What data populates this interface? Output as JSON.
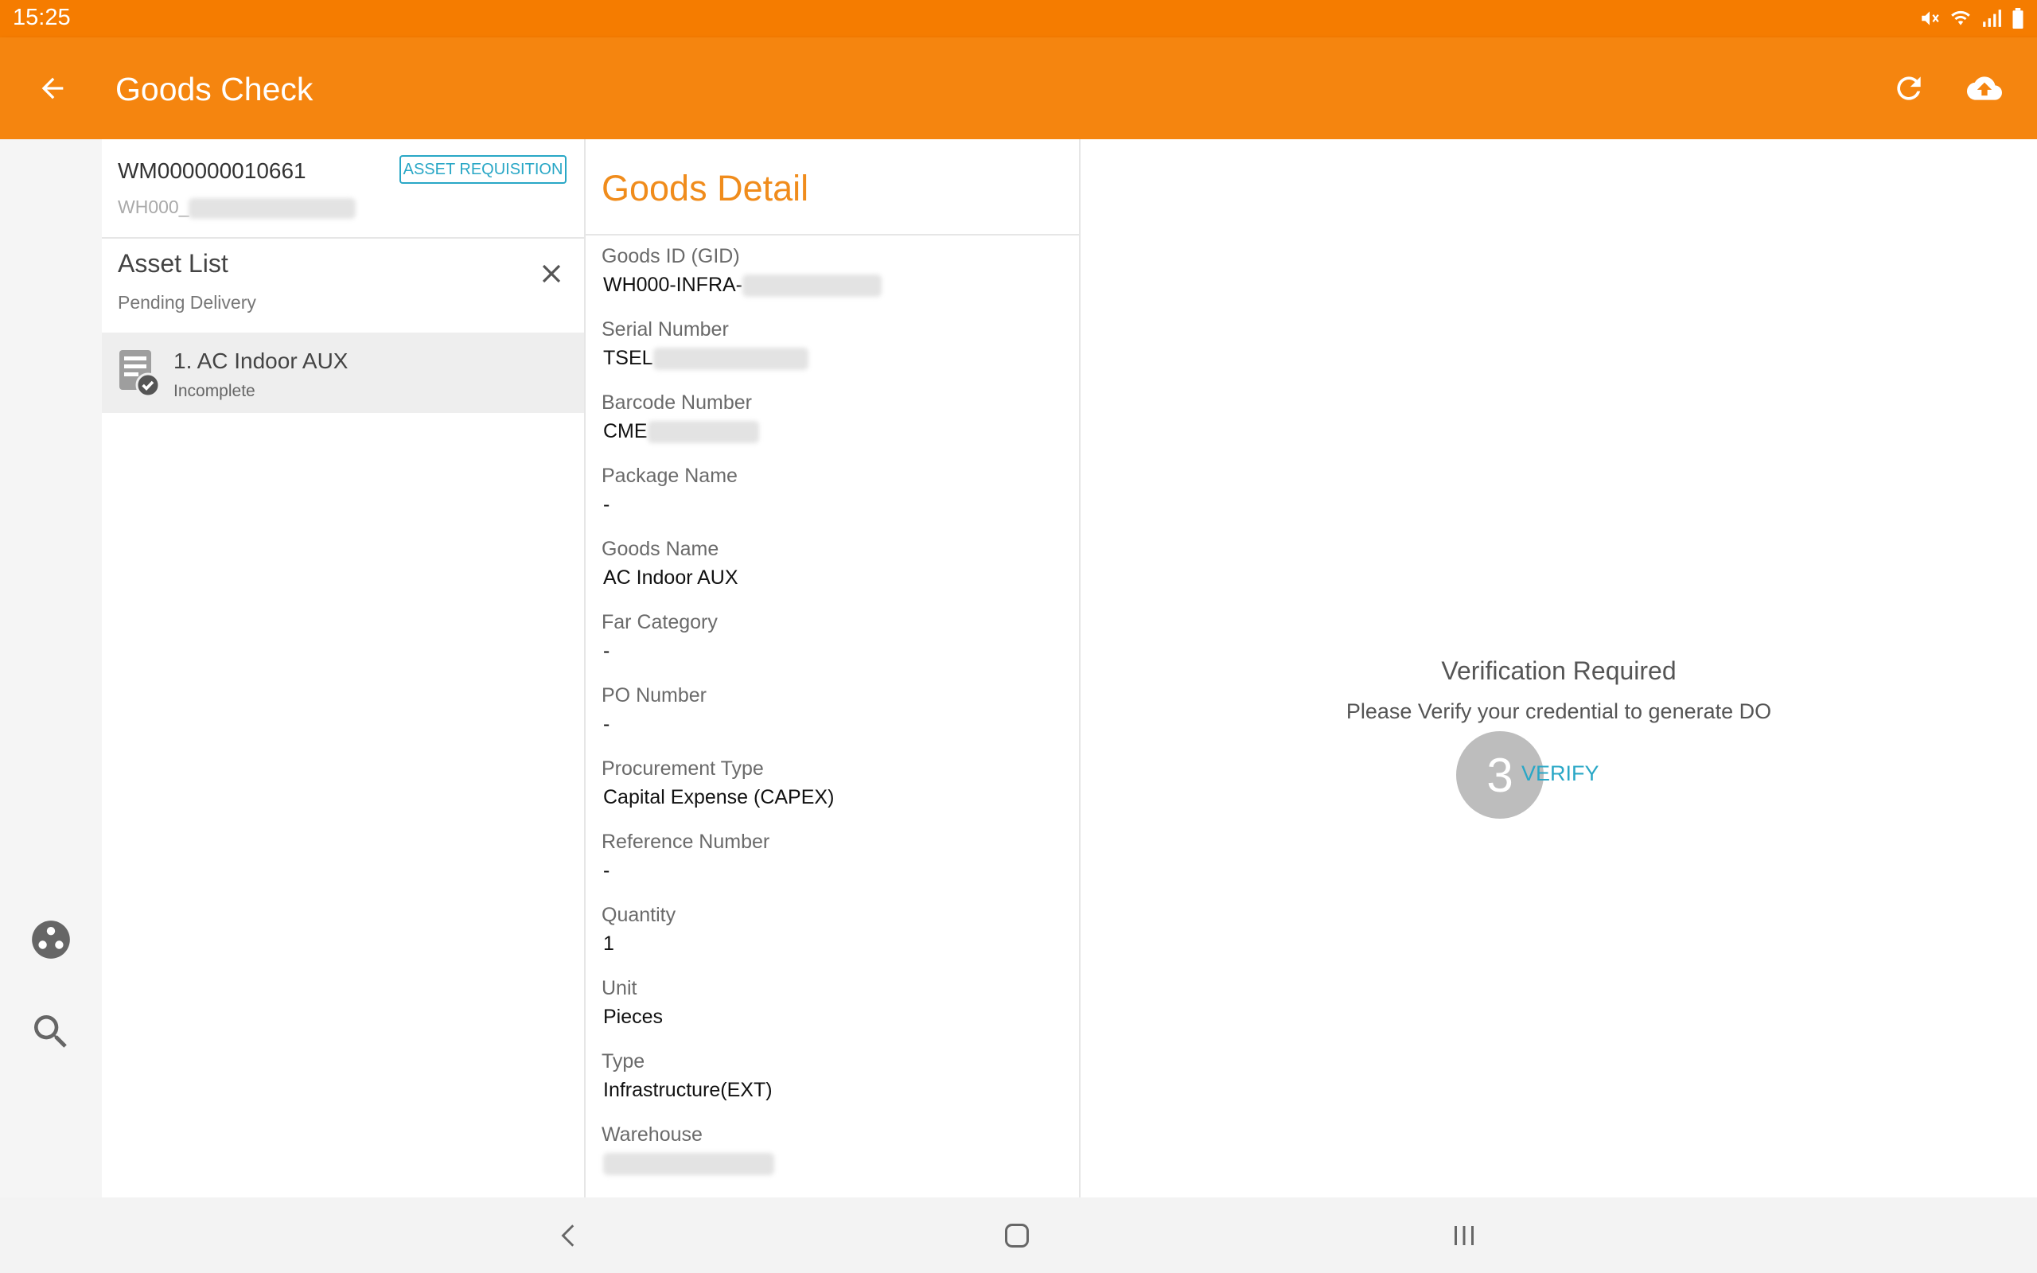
{
  "status_bar": {
    "time": "15:25",
    "icons": [
      "mute-icon",
      "wifi-icon",
      "signal-icon",
      "battery-icon"
    ]
  },
  "app_bar": {
    "title": "Goods Check",
    "icons": [
      "back-arrow-icon",
      "refresh-icon",
      "cloud-upload-icon"
    ]
  },
  "rail": {
    "icons": [
      "scan-icon",
      "search-icon"
    ]
  },
  "request": {
    "id": "WM000000010661",
    "warehouse_prefix": "WH000_",
    "badge": "ASSET REQUISITION"
  },
  "asset_list": {
    "title": "Asset List",
    "subtitle": "Pending Delivery",
    "items": [
      {
        "name": "1. AC Indoor AUX",
        "status": "Incomplete",
        "icon": "document-check-icon"
      }
    ]
  },
  "goods_detail": {
    "title": "Goods Detail",
    "fields": [
      {
        "label": "Goods ID (GID)",
        "value": "WH000-INFRA-"
      },
      {
        "label": "Serial Number",
        "value": "TSEL"
      },
      {
        "label": "Barcode Number",
        "value": "CME"
      },
      {
        "label": "Package Name",
        "value": "-"
      },
      {
        "label": "Goods Name",
        "value": "AC Indoor AUX"
      },
      {
        "label": "Far Category",
        "value": "-"
      },
      {
        "label": "PO Number",
        "value": "-"
      },
      {
        "label": "Procurement Type",
        "value": "Capital Expense (CAPEX)"
      },
      {
        "label": "Reference Number",
        "value": "-"
      },
      {
        "label": "Quantity",
        "value": "1"
      },
      {
        "label": "Unit",
        "value": "Pieces"
      },
      {
        "label": "Type",
        "value": "Infrastructure(EXT)"
      },
      {
        "label": "Warehouse",
        "value": ""
      }
    ]
  },
  "verification": {
    "title": "Verification Required",
    "message": "Please Verify your credential to generate DO",
    "step_number": "3",
    "button_label": "VERIFY"
  },
  "nav_bar": {
    "icons": [
      "nav-back-icon",
      "home-icon",
      "recents-icon"
    ]
  }
}
